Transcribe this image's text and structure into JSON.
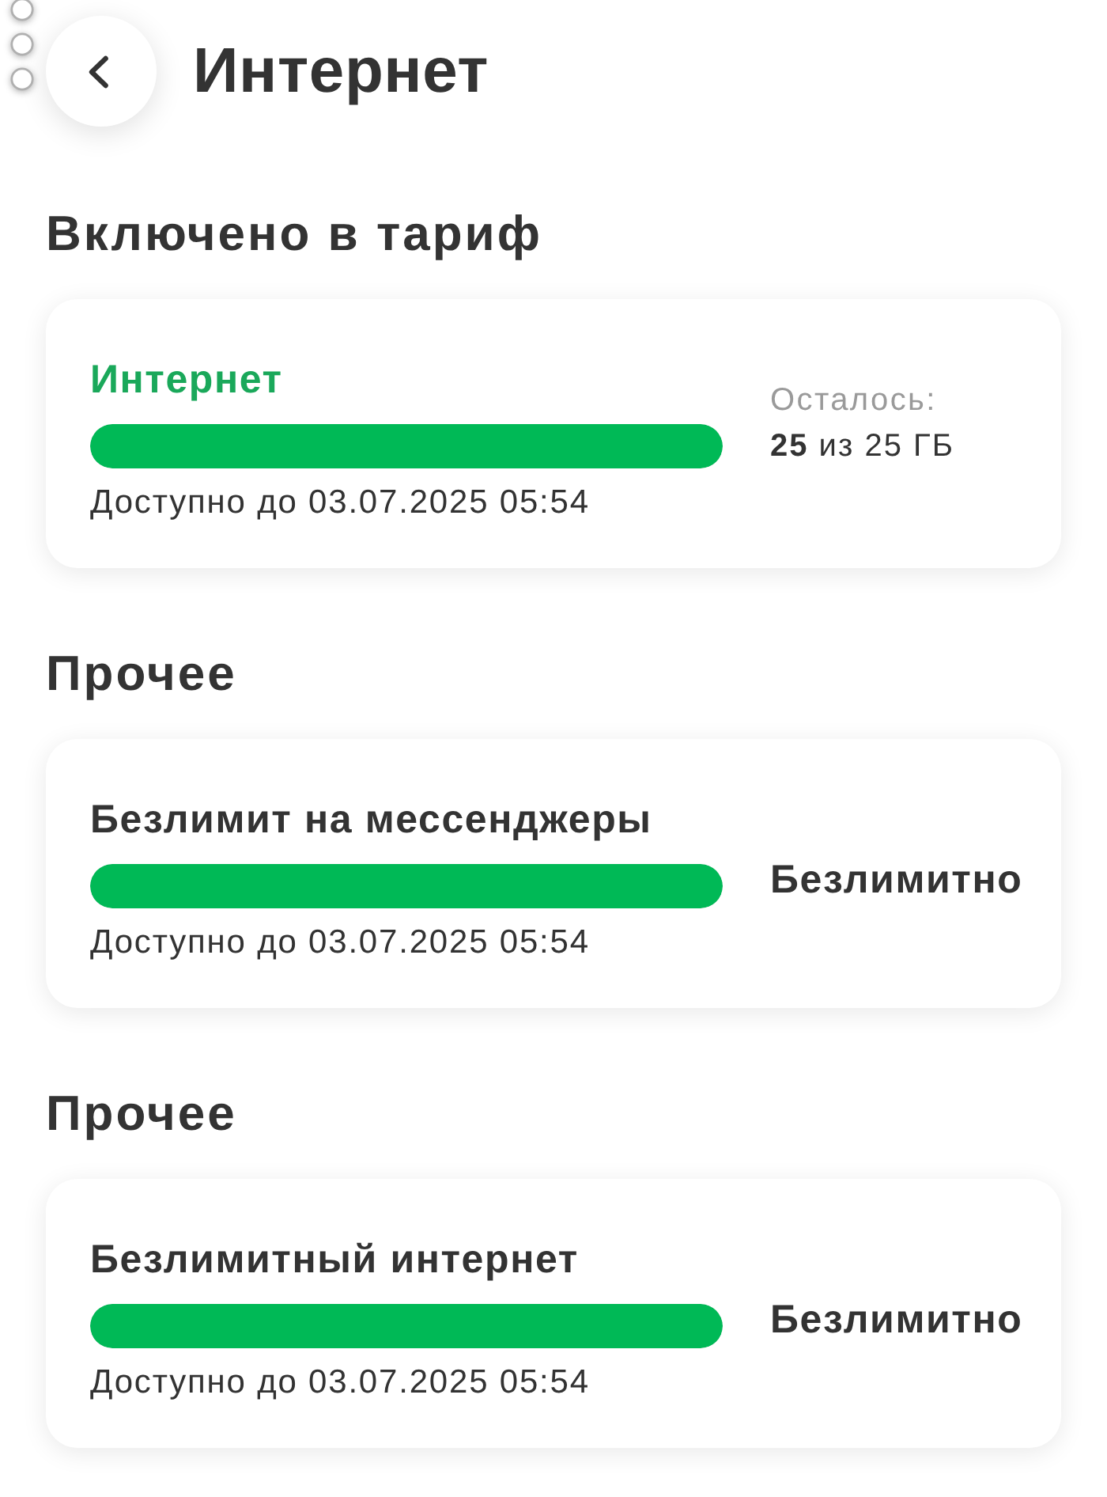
{
  "header": {
    "title": "Интернет"
  },
  "sections": [
    {
      "heading": "Включено в тариф",
      "package": {
        "name": "Интернет",
        "highlighted": true,
        "level": 1,
        "valid_until": "Доступно до 03.07.2025 05:54",
        "balance": {
          "kind": "quota",
          "label": "Осталось:",
          "value": "**25** из 25 ГБ"
        }
      }
    },
    {
      "heading": "Прочее",
      "package": {
        "name": "Безлимит на мессенджеры",
        "highlighted": false,
        "level": 1,
        "valid_until": "Доступно до 03.07.2025 05:54",
        "balance": {
          "kind": "unlimited",
          "value": "Безлимитно"
        }
      }
    },
    {
      "heading": "Прочее",
      "package": {
        "name": "Безлимитный интернет",
        "highlighted": false,
        "level": 1,
        "valid_until": "Доступно до 03.07.2025 05:54",
        "balance": {
          "kind": "unlimited",
          "value": "Безлимитно"
        }
      }
    }
  ]
}
